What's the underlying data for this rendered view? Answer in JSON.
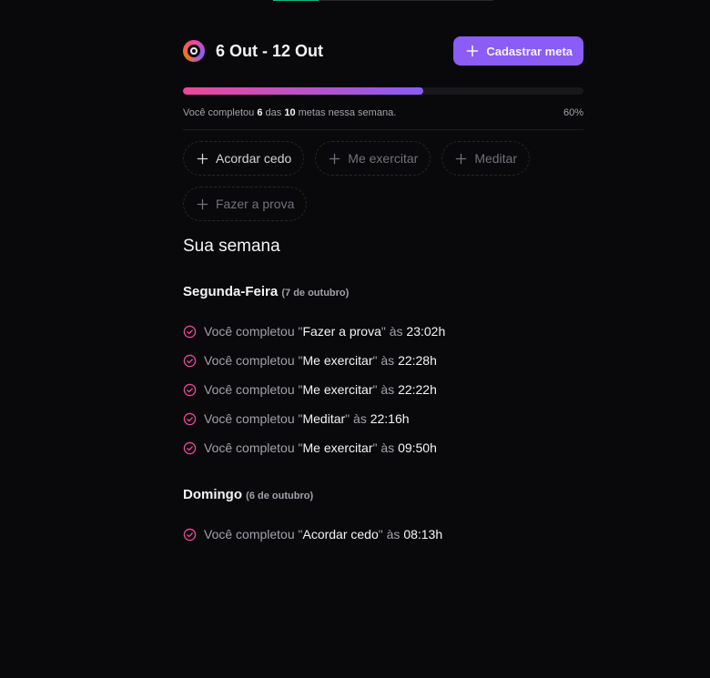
{
  "header": {
    "week_range": "6 Out - 12 Out",
    "create_button_label": "Cadastrar meta"
  },
  "progress": {
    "percent_label": "60%",
    "completed_fraction": 0.6,
    "summary_prefix": "Você completou ",
    "completed_count": "6",
    "summary_middle": " das ",
    "total_count": "10",
    "summary_suffix": " metas nessa semana."
  },
  "pending_goals": [
    {
      "label": "Acordar cedo",
      "muted": false
    },
    {
      "label": "Me exercitar",
      "muted": true
    },
    {
      "label": "Meditar",
      "muted": true
    },
    {
      "label": "Fazer a prova",
      "muted": true
    }
  ],
  "week_heading": "Sua semana",
  "days": [
    {
      "title": "Segunda-Feira",
      "date": "(7 de outubro)",
      "entries": [
        {
          "prefix": "Você completou \"",
          "goal": "Fazer a prova",
          "mid": "\" às ",
          "time": "23:02h"
        },
        {
          "prefix": "Você completou \"",
          "goal": "Me exercitar",
          "mid": "\" às ",
          "time": "22:28h"
        },
        {
          "prefix": "Você completou \"",
          "goal": "Me exercitar",
          "mid": "\" às ",
          "time": "22:22h"
        },
        {
          "prefix": "Você completou \"",
          "goal": "Meditar",
          "mid": "\" às ",
          "time": "22:16h"
        },
        {
          "prefix": "Você completou \"",
          "goal": "Me exercitar",
          "mid": "\" às ",
          "time": "09:50h"
        }
      ]
    },
    {
      "title": "Domingo",
      "date": "(6 de outubro)",
      "entries": [
        {
          "prefix": "Você completou \"",
          "goal": "Acordar cedo",
          "mid": "\" às ",
          "time": "08:13h"
        }
      ]
    }
  ],
  "icons": {
    "logo": "app-logo-icon",
    "add": "plus-icon",
    "completed": "check-circle-icon"
  },
  "colors": {
    "background": "#09090b",
    "accent": "#8b5cf6",
    "gradient_start": "#ec4899",
    "completed_icon": "#ec4899"
  }
}
